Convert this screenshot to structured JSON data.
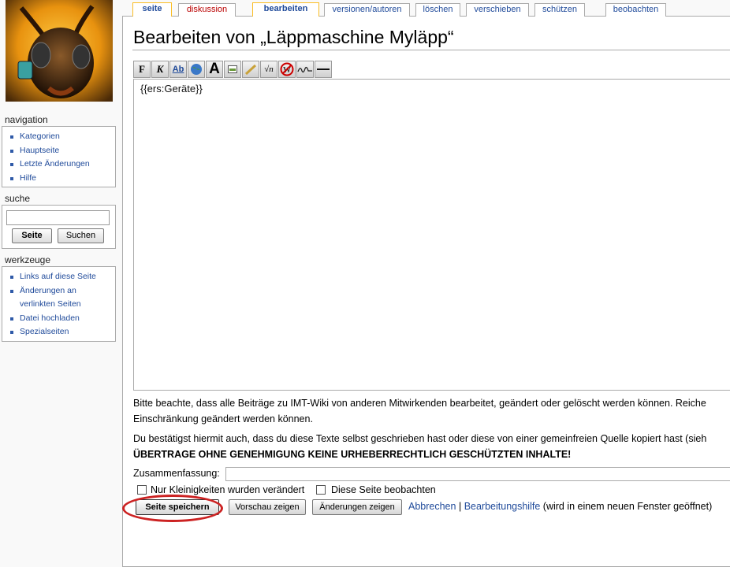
{
  "sidebar": {
    "navigation": {
      "heading": "navigation",
      "items": [
        "Kategorien",
        "Hauptseite",
        "Letzte Änderungen",
        "Hilfe"
      ]
    },
    "search": {
      "heading": "suche",
      "go_label": "Seite",
      "search_label": "Suchen",
      "value": ""
    },
    "tools": {
      "heading": "werkzeuge",
      "items": [
        "Links auf diese Seite",
        "Änderungen an",
        "verlinkten Seiten",
        "Datei hochladen",
        "Spezialseiten"
      ]
    }
  },
  "tabs": [
    {
      "label": "seite"
    },
    {
      "label": "diskussion"
    },
    {
      "label": "bearbeiten",
      "selected": true
    },
    {
      "label": "versionen/autoren"
    },
    {
      "label": "löschen"
    },
    {
      "label": "verschieben"
    },
    {
      "label": "schützen"
    },
    {
      "label": "beobachten"
    }
  ],
  "page": {
    "title": "Bearbeiten von „Läppmaschine Myläpp“"
  },
  "toolbar": {
    "buttons": [
      {
        "icon": "bold-icon",
        "glyph": "F"
      },
      {
        "icon": "italic-icon",
        "glyph": "K"
      },
      {
        "icon": "internal-link-icon",
        "glyph": "Ab"
      },
      {
        "icon": "external-link-icon",
        "glyph": "🌐"
      },
      {
        "icon": "headline-icon",
        "glyph": "A"
      },
      {
        "icon": "embedded-image-icon",
        "glyph": "▬"
      },
      {
        "icon": "media-link-icon",
        "glyph": "♪"
      },
      {
        "icon": "math-formula-icon",
        "glyph": "√n"
      },
      {
        "icon": "nowiki-icon",
        "glyph": "W"
      },
      {
        "icon": "signature-icon",
        "glyph": "✍"
      },
      {
        "icon": "horizontal-line-icon",
        "glyph": "—"
      }
    ]
  },
  "editor": {
    "content": "{{ers:Geräte}}"
  },
  "notices": {
    "line1": "Bitte beachte, dass alle Beiträge zu IMT-Wiki von anderen Mitwirkenden bearbeitet, geändert oder gelöscht werden können. Reiche",
    "line2": "Einschränkung geändert werden können.",
    "line3": "Du bestätigst hiermit auch, dass du diese Texte selbst geschrieben hast oder diese von einer gemeinfreien Quelle kopiert hast (sieh",
    "line4": "ÜBERTRAGE OHNE GENEHMIGUNG KEINE URHEBERRECHTLICH GESCHÜTZTEN INHALTE!"
  },
  "form": {
    "summary_label": "Zusammenfassung:",
    "summary_value": "",
    "minor_label": "Nur Kleinigkeiten wurden verändert",
    "watch_label": "Diese Seite beobachten",
    "save_label": "Seite speichern",
    "preview_label": "Vorschau zeigen",
    "diff_label": "Änderungen zeigen",
    "cancel_label": "Abbrechen",
    "separator": "|",
    "help_label": "Bearbeitungshilfe",
    "help_note": "(wird in einem neuen Fenster geöffnet)"
  },
  "colors": {
    "link": "#1f4a9a",
    "new_link": "#ba0000",
    "selected_tab_border": "#fabd23",
    "highlight": "#cc2222"
  }
}
